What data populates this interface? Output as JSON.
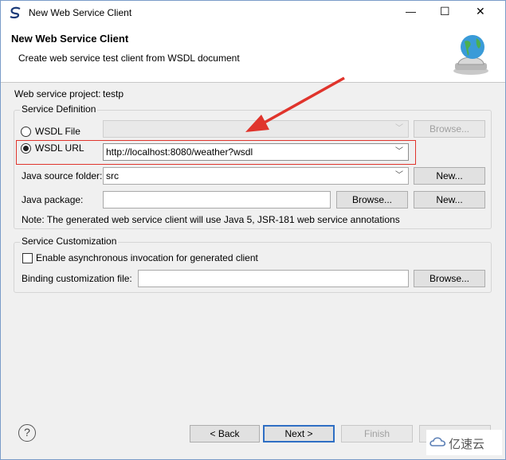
{
  "window": {
    "title": "New Web Service Client",
    "minimize_glyph": "—",
    "maximize_glyph": "☐",
    "close_glyph": "✕"
  },
  "header": {
    "title": "New Web Service Client",
    "description": "Create web service test client from WSDL document",
    "icon": "web-service-globe-icon"
  },
  "project": {
    "label": "Web service project:",
    "value": "testp"
  },
  "service_definition": {
    "legend": "Service Definition",
    "wsdl_file": {
      "label": "WSDL File",
      "value": "",
      "browse_label": "Browse...",
      "checked": false
    },
    "wsdl_url": {
      "label": "WSDL URL",
      "value": "http://localhost:8080/weather?wsdl",
      "checked": true
    },
    "java_source_folder": {
      "label": "Java source folder:",
      "value": "src",
      "new_label": "New..."
    },
    "java_package": {
      "label": "Java package:",
      "value": "",
      "browse_label": "Browse...",
      "new_label": "New..."
    },
    "note": "Note: The generated web service client will use Java 5, JSR-181 web service annotations"
  },
  "service_customization": {
    "legend": "Service Customization",
    "async_label": "Enable asynchronous invocation for generated client",
    "async_checked": false,
    "binding_label": "Binding customization file:",
    "binding_value": "",
    "browse_label": "Browse..."
  },
  "footer": {
    "help_glyph": "?",
    "back_label": "< Back",
    "next_label": "Next >",
    "finish_label": "Finish"
  },
  "watermark": {
    "text": "亿速云"
  },
  "colors": {
    "annotation_red": "#e0342c",
    "window_border": "#7a9cc8",
    "default_button": "#2f6fc4"
  }
}
